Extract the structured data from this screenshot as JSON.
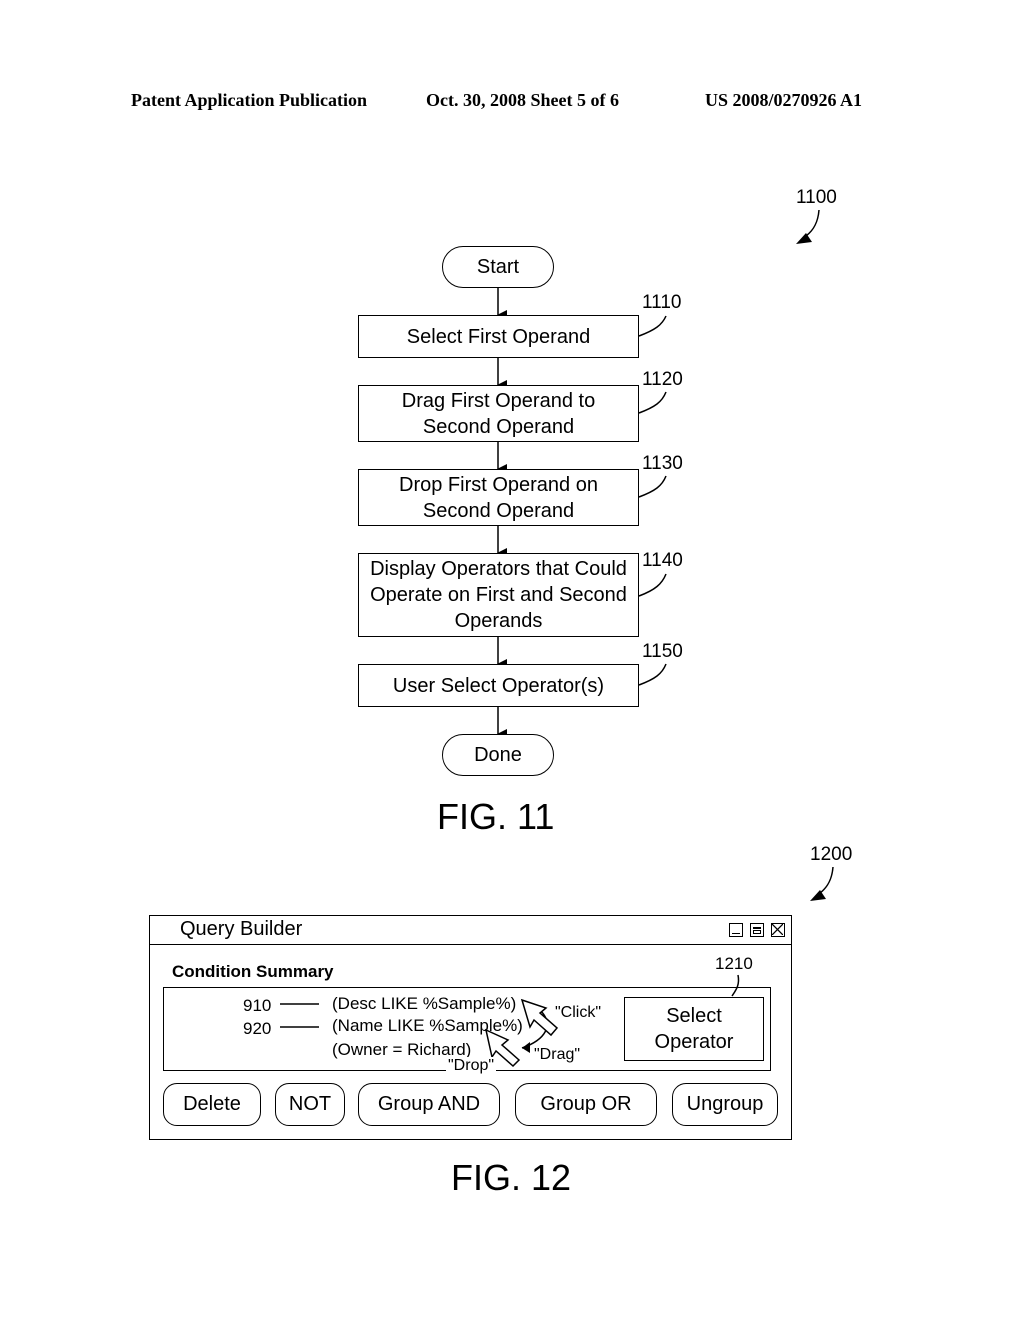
{
  "header": {
    "left": "Patent Application Publication",
    "center": "Oct. 30, 2008   Sheet 5 of 6",
    "right": "US 2008/0270926 A1"
  },
  "fig11": {
    "ref": "1100",
    "start": "Start",
    "done": "Done",
    "steps": [
      {
        "ref": "1110",
        "label": "Select First Operand"
      },
      {
        "ref": "1120",
        "label": "Drag First Operand to Second Operand"
      },
      {
        "ref": "1130",
        "label": "Drop First Operand on Second Operand"
      },
      {
        "ref": "1140",
        "label": "Display Operators that Could Operate on First and Second Operands"
      },
      {
        "ref": "1150",
        "label": "User Select Operator(s)"
      }
    ],
    "caption": "FIG. 11"
  },
  "fig12": {
    "ref": "1200",
    "window_title": "Query Builder",
    "window_controls": [
      "minimize-icon",
      "maximize-icon",
      "close-icon"
    ],
    "section_label": "Condition Summary",
    "conditions": [
      {
        "ref": "910",
        "text": "(Desc LIKE %Sample%)"
      },
      {
        "ref": "920",
        "text": "(Name LIKE %Sample%)"
      },
      {
        "ref": "",
        "text": "(Owner = Richard)"
      }
    ],
    "annotations": {
      "click": "\"Click\"",
      "drag": "\"Drag\"",
      "drop": "\"Drop\""
    },
    "select_operator": {
      "ref": "1210",
      "label": "Select Operator"
    },
    "buttons": [
      "Delete",
      "NOT",
      "Group AND",
      "Group OR",
      "Ungroup"
    ],
    "caption": "FIG. 12"
  }
}
